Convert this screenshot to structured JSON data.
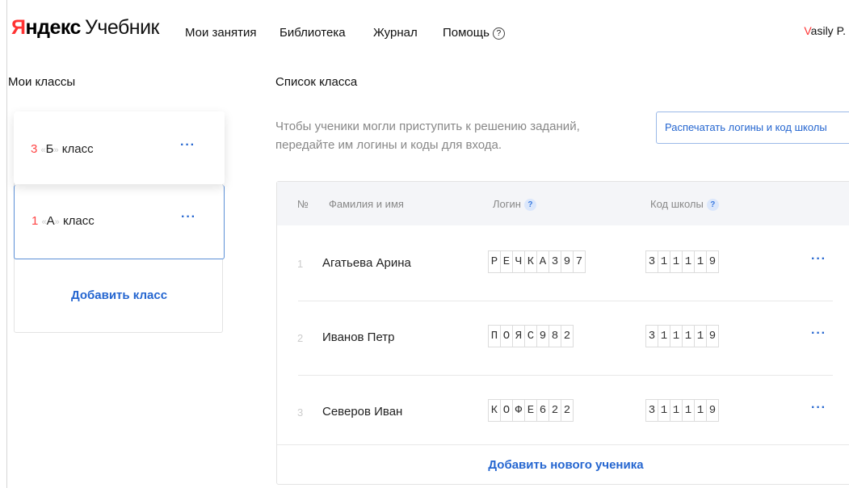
{
  "header": {
    "logo_brand_first": "Я",
    "logo_brand_rest": "ндекс",
    "logo_product": "Учебник",
    "nav": [
      {
        "label": "Мои занятия"
      },
      {
        "label": "Библиотека"
      },
      {
        "label": "Журнал"
      },
      {
        "label": "Помощь"
      }
    ],
    "help_glyph": "?",
    "user_first": "V",
    "user_rest": "asily P."
  },
  "sidebar": {
    "title": "Мои классы",
    "classes": [
      {
        "grade": "3",
        "letter": "Б",
        "word": "класс",
        "menu": "···"
      },
      {
        "grade": "1",
        "letter": "А",
        "word": "класс",
        "menu": "···"
      }
    ],
    "quote_open": "«",
    "quote_close": "»",
    "add_class": "Добавить класс"
  },
  "main": {
    "title": "Список класса",
    "hint": "Чтобы ученики могли приступить к решению заданий, передайте им логины и коды для входа.",
    "print_button": "Распечатать логины и код школы",
    "table": {
      "headers": {
        "num": "№",
        "name": "Фамилия и имя",
        "login": "Логин",
        "school_code": "Код школы",
        "help": "?"
      },
      "rows": [
        {
          "num": "1",
          "name": "Агатьева Арина",
          "login": "РЕЧКА397",
          "school_code": "311119",
          "menu": "···"
        },
        {
          "num": "2",
          "name": "Иванов Петр",
          "login": "ПОЯС982",
          "school_code": "311119",
          "menu": "···"
        },
        {
          "num": "3",
          "name": "Северов Иван",
          "login": "КОФЕ622",
          "school_code": "311119",
          "menu": "···"
        }
      ]
    },
    "add_student": "Добавить нового ученика"
  },
  "colors": {
    "accent_blue": "#2566d0",
    "brand_red": "#ff3333",
    "header_gray": "#f4f5f8"
  }
}
